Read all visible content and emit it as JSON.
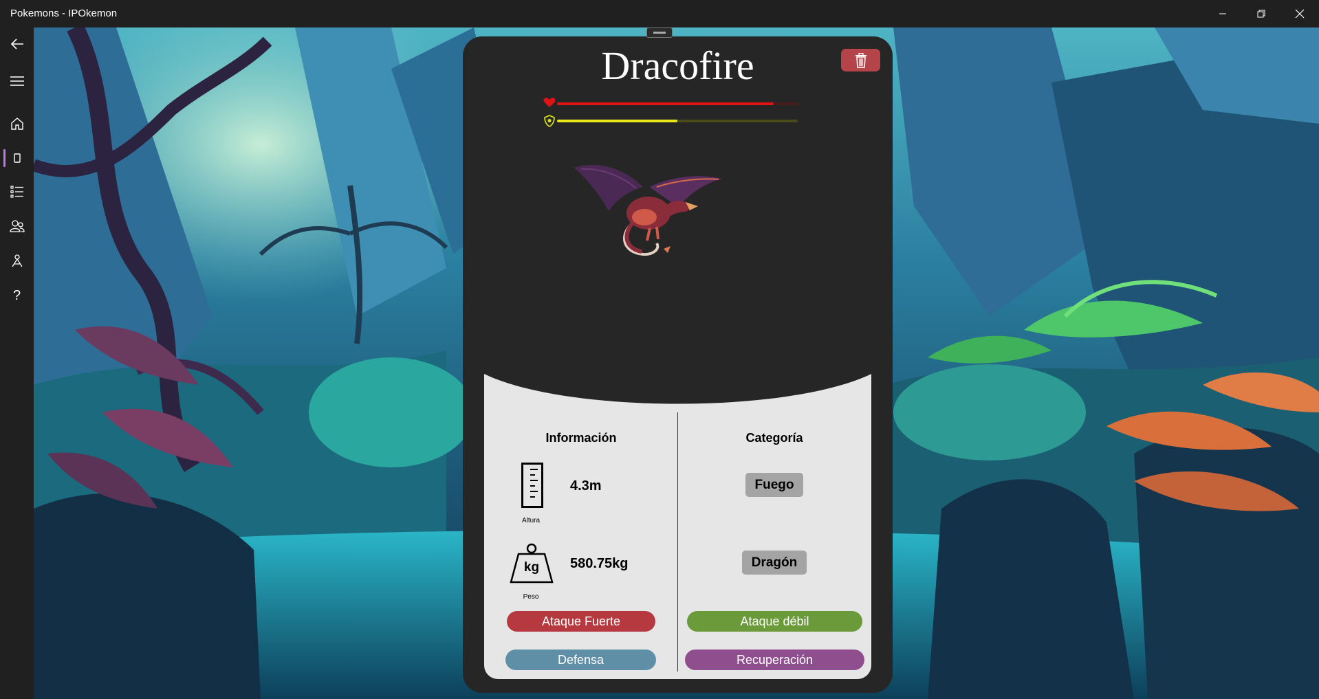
{
  "window": {
    "title": "Pokemons - IPOkemon",
    "minimize_icon": "minimize-icon",
    "maximize_icon": "restore-icon",
    "close_icon": "close-icon"
  },
  "nav": {
    "items": [
      {
        "icon": "back-arrow-icon"
      },
      {
        "icon": "hamburger-menu-icon"
      },
      {
        "icon": "home-icon"
      },
      {
        "icon": "pokedex-icon",
        "selected": true
      },
      {
        "icon": "list-icon"
      },
      {
        "icon": "people-icon"
      },
      {
        "icon": "battle-icon"
      },
      {
        "icon": "help-icon"
      }
    ],
    "help_glyph": "?",
    "accent_color": "#c377e0"
  },
  "pokemon": {
    "name": "Dracofire",
    "health_level": 0.9,
    "shield_level": 0.5,
    "health_color": "#e01414",
    "shield_color": "#e6e617",
    "info": {
      "heading": "Información",
      "height_value": "4.3m",
      "height_caption": "Altura",
      "weight_value": "580.75kg",
      "weight_caption": "Peso",
      "weight_icon_text": "kg"
    },
    "category": {
      "heading": "Categoría",
      "types": [
        "Fuego",
        "Dragón"
      ]
    },
    "actions": {
      "strong_attack": "Ataque Fuerte",
      "weak_attack": "Ataque débil",
      "defense": "Defensa",
      "recovery": "Recuperación"
    },
    "colors": {
      "strong_attack": "#b5393f",
      "weak_attack": "#6b9a3a",
      "defense": "#5f8fa6",
      "recovery": "#8f4f8f",
      "delete": "#b5444a"
    }
  }
}
